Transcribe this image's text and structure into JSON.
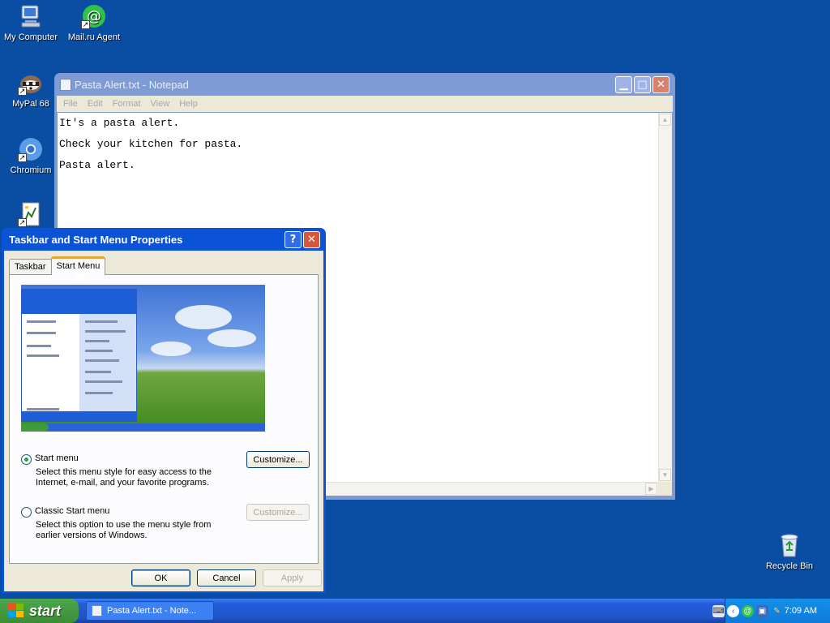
{
  "desktop": {
    "icons": [
      {
        "label": "My Computer",
        "icon": "my-computer-icon"
      },
      {
        "label": "Mail.ru Agent",
        "icon": "mail-ru-agent-icon"
      },
      {
        "label": "MyPal 68",
        "icon": "mypal-raccoon-icon"
      },
      {
        "label": "Chromium",
        "icon": "chromium-icon"
      },
      {
        "label": "Recycle Bin",
        "icon": "recycle-bin-icon"
      }
    ]
  },
  "notepad": {
    "title": "Pasta Alert.txt - Notepad",
    "menu": [
      "File",
      "Edit",
      "Format",
      "View",
      "Help"
    ],
    "lines": [
      "It's a pasta alert.",
      "Check your kitchen for pasta.",
      "Pasta alert."
    ]
  },
  "dialog": {
    "title": "Taskbar and Start Menu Properties",
    "tabs": [
      "Taskbar",
      "Start Menu"
    ],
    "options": {
      "start_menu": {
        "label": "Start menu",
        "desc_1": "Select this menu style for easy access to the",
        "desc_2": "Internet, e-mail, and your favorite programs.",
        "customize": "Customize..."
      },
      "classic": {
        "label": "Classic Start menu",
        "desc_1": "Select this option to use the menu style from",
        "desc_2": "earlier versions of Windows.",
        "customize": "Customize..."
      }
    },
    "buttons": {
      "ok": "OK",
      "cancel": "Cancel",
      "apply": "Apply"
    }
  },
  "taskbar": {
    "start_label": "start",
    "task_title": "Pasta Alert.txt - Note...",
    "clock": "7:09 AM"
  },
  "colors": {
    "desktop": "#0a4ea3",
    "taskbar": "#245edb",
    "start_button": "#3c8d36",
    "tab_highlight": "#e8a33b"
  }
}
